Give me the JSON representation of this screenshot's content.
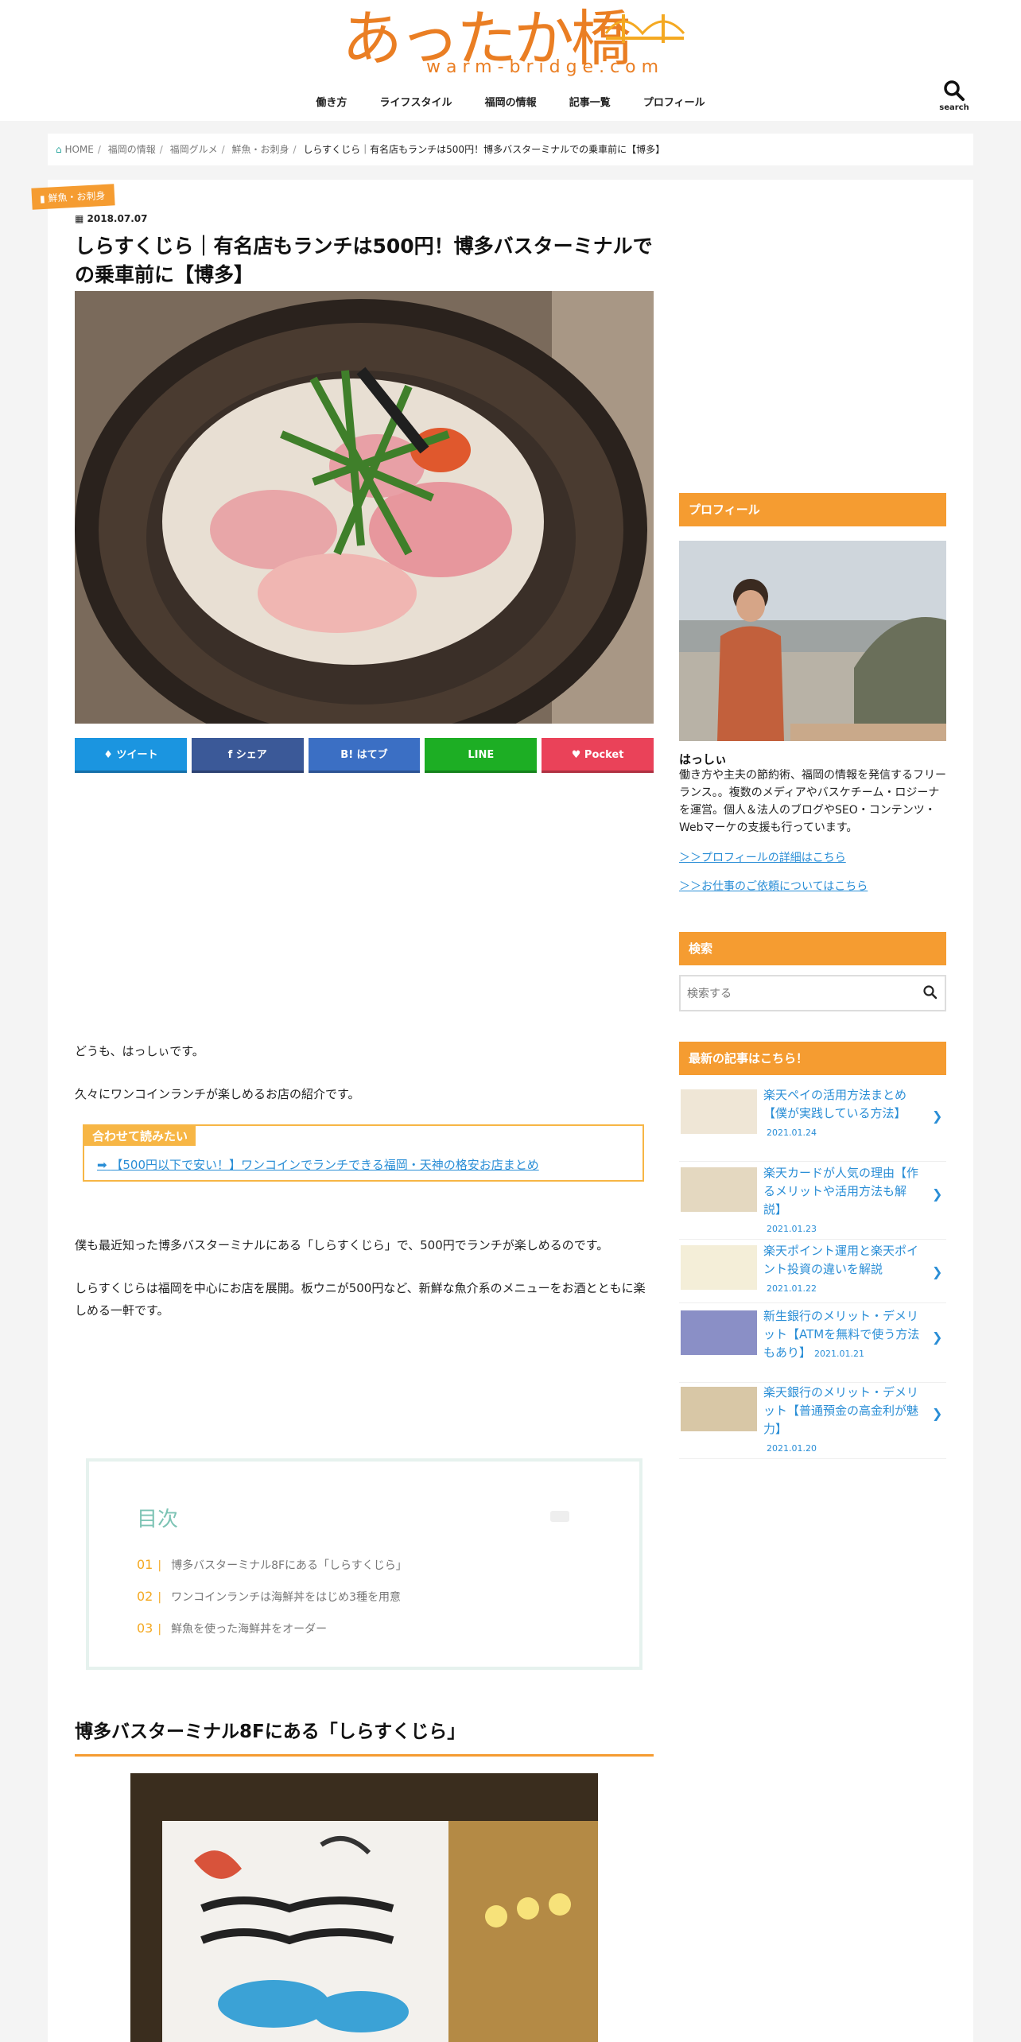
{
  "header": {
    "logo_jp": "あったか橋",
    "logo_en": "warm-bridge.com",
    "nav": [
      "働き方",
      "ライフスタイル",
      "福岡の情報",
      "記事一覧",
      "プロフィール"
    ],
    "search_label": "search"
  },
  "breadcrumb": [
    "HOME",
    "福岡の情報",
    "福岡グルメ",
    "鮮魚・お刺身",
    "しらすくじら｜有名店もランチは500円！博多バスターミナルでの乗車前に【博多】"
  ],
  "article": {
    "category": "鮮魚・お刺身",
    "date": "2018.07.07",
    "title": "しらすくじら｜有名店もランチは500円！博多バスターミナルでの乗車前に【博多】",
    "share": [
      {
        "label": "ツイート",
        "color": "#1b95e0"
      },
      {
        "label": "シェア",
        "color": "#3b5998"
      },
      {
        "label": "B! はてブ",
        "color": "#3b6fc4"
      },
      {
        "label": "LINE",
        "color": "#1dae24"
      },
      {
        "label": "Pocket",
        "color": "#ea4259"
      }
    ],
    "p1": "どうも、はっしぃです。",
    "p2": "久々にワンコインランチが楽しめるお店の紹介です。",
    "related_heading": "合わせて読みたい",
    "related_link": "【500円以下で安い！】ワンコインでランチできる福岡・天神の格安お店まとめ",
    "p3": "僕も最近知った博多バスターミナルにある「しらすくじら」で、500円でランチが楽しめるのです。",
    "p4": "しらすくじらは福岡を中心にお店を展開。板ウニが500円など、新鮮な魚介系のメニューをお酒とともに楽しめる一軒です。",
    "toc": {
      "title": "目次",
      "items": [
        {
          "num": "01",
          "label": "博多バスターミナル8Fにある「しらすくじら」"
        },
        {
          "num": "02",
          "label": "ワンコインランチは海鮮丼をはじめ3種を用意"
        },
        {
          "num": "03",
          "label": "鮮魚を使った海鮮丼をオーダー"
        }
      ]
    },
    "h2": "博多バスターミナル8Fにある「しらすくじら」"
  },
  "sidebar": {
    "profile_heading": "プロフィール",
    "profile_name": "はっしぃ",
    "profile_text": "働き方や主夫の節約術、福岡の情報を発信するフリーランス。。複数のメディアやバスケチーム・ロジーナを運営。個人＆法人のブログやSEO・コンテンツ・Webマーケの支援も行っています。",
    "profile_link1": "＞＞プロフィールの詳細はこちら",
    "profile_link2": "＞＞お仕事のご依頼についてはこちら",
    "search_heading": "検索",
    "search_placeholder": "検索する",
    "recent_heading": "最新の記事はこちら！",
    "recent": [
      {
        "title": "楽天ペイの活用方法まとめ【僕が実践している方法】",
        "date": "2021.01.24"
      },
      {
        "title": "楽天カードが人気の理由【作るメリットや活用方法も解説】",
        "date": "2021.01.23"
      },
      {
        "title": "楽天ポイント運用と楽天ポイント投資の違いを解説",
        "date": "2021.01.22"
      },
      {
        "title": "新生銀行のメリット・デメリット【ATMを無料で使う方法もあり】",
        "date": "2021.01.21"
      },
      {
        "title": "楽天銀行のメリット・デメリット【普通預金の高金利が魅力】",
        "date": "2021.01.20"
      }
    ]
  }
}
